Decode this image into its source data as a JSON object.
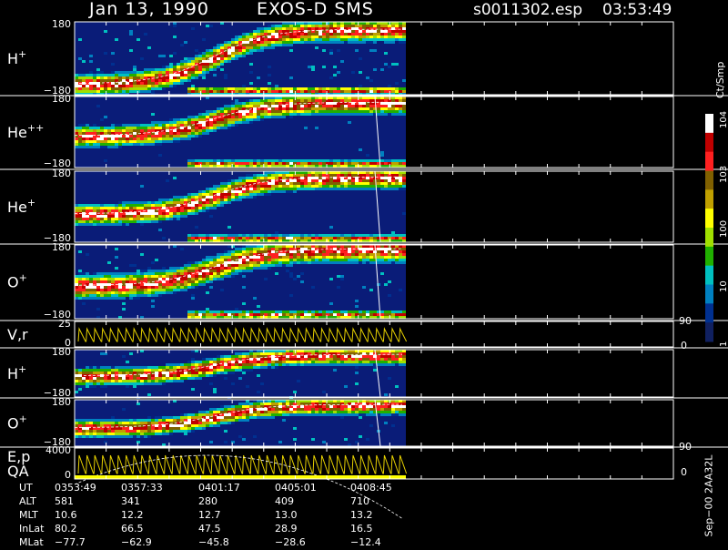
{
  "header": {
    "date": "Jan 13, 1990",
    "instrument": "EXOS-D SMS",
    "file": "s0011302.esp",
    "time": "03:53:49"
  },
  "colorbar": {
    "unit_label": "Ct/Smp",
    "tick_labels": [
      "10^4",
      "10^3",
      "100",
      "10",
      "1"
    ],
    "colors": [
      "#ffffff",
      "#c00000",
      "#ff2020",
      "#806000",
      "#c0a000",
      "#ffff00",
      "#a0e000",
      "#20b000",
      "#00c0c0",
      "#0080c0",
      "#003090",
      "#102060"
    ]
  },
  "panels": [
    {
      "id": "h_plus",
      "label": "H",
      "sup": "+",
      "ytop": "180",
      "ybot": "−180"
    },
    {
      "id": "he_pp",
      "label": "He",
      "sup": "++",
      "ytop": "180",
      "ybot": "−180"
    },
    {
      "id": "he_plus",
      "label": "He",
      "sup": "+",
      "ytop": "180",
      "ybot": "−180"
    },
    {
      "id": "o_plus",
      "label": "O",
      "sup": "+",
      "ytop": "180",
      "ybot": "−180"
    },
    {
      "id": "vr",
      "label": "V,r",
      "sup": "",
      "ytop": "25",
      "ybot": "0",
      "right_top": "90",
      "right_bot": "0"
    },
    {
      "id": "h_plus2",
      "label": "H",
      "sup": "+",
      "ytop": "180",
      "ybot": "−180"
    },
    {
      "id": "o_plus2",
      "label": "O",
      "sup": "+",
      "ytop": "180",
      "ybot": "−180"
    },
    {
      "id": "ep",
      "label": "E,p",
      "label2": "QA",
      "sup": "",
      "ytop": "4000",
      "ybot": "0",
      "right_top": "90",
      "right_bot": "0"
    }
  ],
  "side_text": "Sep−00  2AA32L",
  "footer": {
    "rows": [
      {
        "name": "UT",
        "values": [
          "0353:49",
          "0357:33",
          "0401:17",
          "0405:01",
          "0408:45"
        ]
      },
      {
        "name": "ALT",
        "values": [
          "581",
          "341",
          "280",
          "409",
          "710"
        ]
      },
      {
        "name": "MLT",
        "values": [
          "10.6",
          "12.2",
          "12.7",
          "13.0",
          "13.2"
        ]
      },
      {
        "name": "InLat",
        "values": [
          "80.2",
          "66.5",
          "47.5",
          "28.9",
          "16.5"
        ]
      },
      {
        "name": "MLat",
        "values": [
          "−77.7",
          "−62.9",
          "−45.8",
          "−28.6",
          "−12.4"
        ]
      }
    ]
  },
  "chart_data": {
    "type": "heatmap",
    "title": "Jan 13, 1990   EXOS-D SMS",
    "xlabel": "UT",
    "x_ticks": [
      "0353:49",
      "0357:33",
      "0401:17",
      "0405:01",
      "0408:45"
    ],
    "panels": [
      {
        "name": "H+",
        "ylim": [
          -180,
          180
        ]
      },
      {
        "name": "He++",
        "ylim": [
          -180,
          180
        ]
      },
      {
        "name": "He+",
        "ylim": [
          -180,
          180
        ]
      },
      {
        "name": "O+",
        "ylim": [
          -180,
          180
        ]
      },
      {
        "name": "V,r",
        "ylim": [
          0,
          25
        ],
        "right_ylim": [
          0,
          90
        ]
      },
      {
        "name": "H+",
        "ylim": [
          -180,
          180
        ]
      },
      {
        "name": "O+",
        "ylim": [
          -180,
          180
        ]
      },
      {
        "name": "E,p QA",
        "ylim": [
          0,
          4000
        ],
        "right_ylim": [
          0,
          90
        ]
      }
    ],
    "colorbar": {
      "label": "Ct/Smp",
      "scale": "log",
      "range": [
        1,
        10000
      ]
    }
  }
}
